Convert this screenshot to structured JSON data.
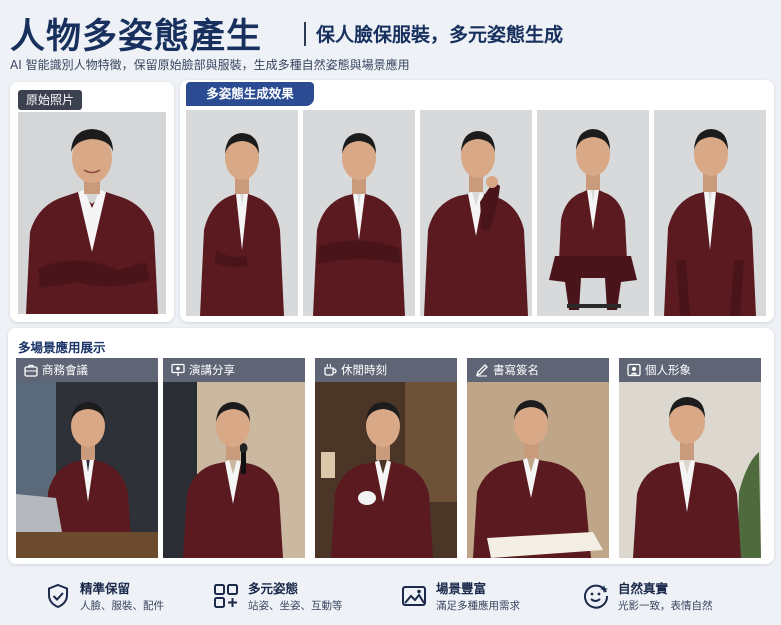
{
  "header": {
    "title": "人物多姿態產生",
    "subtitle": "保人臉保服裝，多元姿態生成",
    "description": "AI 智能識別人物特徵，保留原始臉部與服裝，生成多種自然姿態與場景應用"
  },
  "original": {
    "label": "原始照片"
  },
  "poses": {
    "label": "多姿態生成效果"
  },
  "scenes": {
    "title": "多場景應用展示",
    "items": [
      {
        "label": "商務會議",
        "icon": "briefcase-icon"
      },
      {
        "label": "演講分享",
        "icon": "presentation-icon"
      },
      {
        "label": "休閒時刻",
        "icon": "coffee-cup-icon"
      },
      {
        "label": "書寫簽名",
        "icon": "pen-icon"
      },
      {
        "label": "個人形象",
        "icon": "portrait-icon"
      }
    ]
  },
  "features": [
    {
      "title": "精準保留",
      "desc": "人臉、服裝、配件",
      "icon": "shield-check-icon"
    },
    {
      "title": "多元姿態",
      "desc": "站姿、坐姿、互動等",
      "icon": "grid-icon"
    },
    {
      "title": "場景豐富",
      "desc": "滿足多種應用需求",
      "icon": "landscape-image-icon"
    },
    {
      "title": "自然真實",
      "desc": "光影一致，表情自然",
      "icon": "smile-icon"
    }
  ],
  "colors": {
    "suit": "#5a1a20",
    "accent": "#2b4c93",
    "title": "#18305e"
  }
}
